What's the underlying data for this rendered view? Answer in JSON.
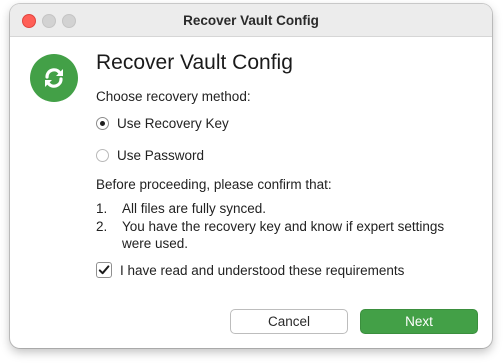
{
  "window": {
    "title": "Recover Vault Config"
  },
  "heading": "Recover Vault Config",
  "method_prompt": "Choose recovery method:",
  "methods": [
    {
      "label": "Use Recovery Key",
      "selected": true
    },
    {
      "label": "Use Password",
      "selected": false
    }
  ],
  "confirm_prompt": "Before proceeding, please confirm that:",
  "requirements": [
    {
      "num": "1.",
      "text": "All files are fully synced."
    },
    {
      "num": "2.",
      "text": "You have the recovery key and know if expert settings were used."
    }
  ],
  "acknowledge": {
    "label": "I have read and understood these requirements",
    "checked": true
  },
  "buttons": {
    "cancel": "Cancel",
    "next": "Next"
  },
  "colors": {
    "accent": "#43a047",
    "close": "#ff5f57"
  },
  "icons": {
    "app": "sync-arrows-icon",
    "check": "checkmark-icon"
  }
}
